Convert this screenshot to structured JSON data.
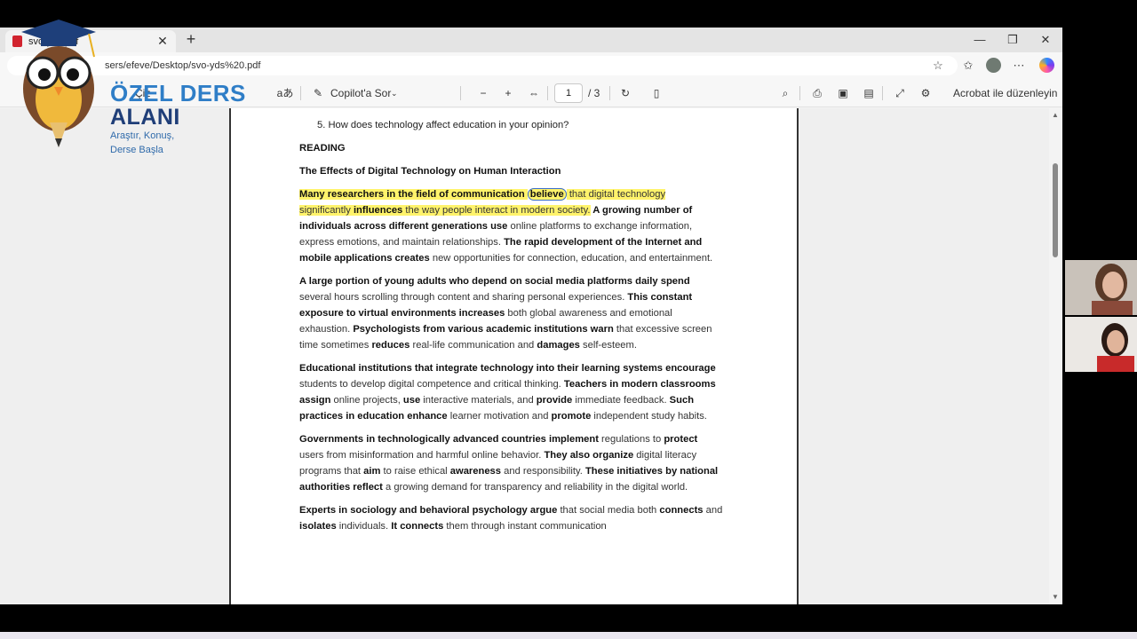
{
  "browser": {
    "tab_title": "svo-yds.pdf",
    "url": "sers/efeve/Desktop/svo-yds%20.pdf"
  },
  "pdf_toolbar": {
    "draw_label": "Çiz",
    "copilot_label": "Copilot'a Sor",
    "page_current": "1",
    "page_total": "/ 3",
    "acrobat_label": "Acrobat ile düzenleyin"
  },
  "logo": {
    "line1": "ÖZEL DERS",
    "line2": "ALANI",
    "tagline1": "Araştır, Konuş,",
    "tagline2": "Derse Başla"
  },
  "document": {
    "question": "5.   How does technology affect education in your opinion?",
    "section": "READING",
    "title": "The Effects of Digital Technology on Human Interaction",
    "p1": {
      "a": "Many researchers in the field of communication ",
      "b": "believe",
      "c": " that digital technology",
      "d": "significantly ",
      "e": "influences",
      "f": " the way people interact in modern society.",
      "g": " A growing number of individuals across different generations use",
      "h": " online platforms to exchange information, express emotions, and maintain relationships. ",
      "i": "The rapid development of the Internet and mobile applications creates",
      "j": " new opportunities for connection, education, and entertainment."
    },
    "p2": {
      "a": "A large portion of young adults who depend on social media platforms daily spend",
      "b": " several hours scrolling through content and sharing personal experiences. ",
      "c": "This constant exposure to virtual environments increases",
      "d": " both global awareness and emotional exhaustion. ",
      "e": "Psychologists from various academic institutions warn",
      "f": " that excessive screen time sometimes ",
      "g": "reduces",
      "h": " real-life communication and ",
      "i": "damages",
      "j": " self-esteem."
    },
    "p3": {
      "a": "Educational institutions that integrate technology into their learning systems encourage",
      "b": " students to develop digital competence and critical thinking. ",
      "c": "Teachers in modern classrooms assign",
      "d": " online projects, ",
      "e": "use",
      "f": " interactive materials, and ",
      "g": "provide",
      "h": " immediate feedback. ",
      "i": "Such practices in education enhance",
      "j": " learner motivation and ",
      "k": "promote",
      "l": " independent study habits."
    },
    "p4": {
      "a": "Governments in technologically advanced countries implement",
      "b": " regulations to ",
      "c": "protect",
      "d": " users from misinformation and harmful online behavior. ",
      "e": "They also organize",
      "f": " digital literacy programs that ",
      "g": "aim",
      "h": " to raise ethical ",
      "i": "awareness",
      "j": " and responsibility. ",
      "k": "These initiatives by national authorities reflect",
      "l": " a growing demand for transparency and reliability in the digital world."
    },
    "p5": {
      "a": "Experts in sociology and behavioral psychology argue",
      "b": " that social media both ",
      "c": "connects",
      "d": " and ",
      "e": "isolates",
      "f": " individuals. ",
      "g": "It connects",
      "h": " them through instant communication"
    }
  },
  "colors": {
    "highlight": "#fff36b",
    "ink_circle": "#3a6ec8",
    "brand_light": "#2f7ec7",
    "brand_dark": "#1f3e78"
  },
  "icons": [
    "pdf-icon",
    "close-icon",
    "plus-icon",
    "star-icon",
    "favorites-icon",
    "profile-icon",
    "more-icon",
    "copilot-icon",
    "read-aloud-icon",
    "copilot-chat-icon",
    "zoom-out-icon",
    "zoom-in-icon",
    "fit-page-icon",
    "rotate-icon",
    "page-view-icon",
    "search-icon",
    "print-icon",
    "save-icon",
    "save-as-icon",
    "fullscreen-icon",
    "settings-icon",
    "acrobat-icon"
  ]
}
